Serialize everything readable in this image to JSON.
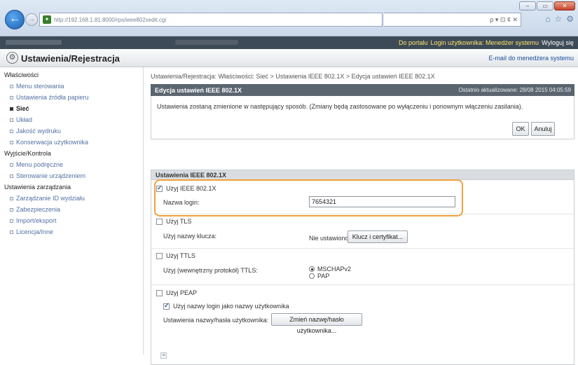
{
  "browser": {
    "window_buttons": [
      "–",
      "▭",
      "✕"
    ],
    "address_url": "http://192.168.1.81:8000/rps/ieee802xedit.cgi",
    "address_right": "ρ ▾ ⊡ ¢ ✕",
    "right_icons": [
      "⌂",
      "☆",
      "⚙"
    ]
  },
  "topbar": {
    "portal_link": "Do portalu",
    "login_label": "Login użytkownika: Menedżer systemu",
    "logout_link": "Wyloguj się"
  },
  "titlebar": {
    "icon": "gear-icon",
    "title": "Ustawienia/Rejestracja",
    "mail_link": "E-mail do menedżera systemu"
  },
  "sidebar": {
    "groups": [
      {
        "heading": "Właściwości",
        "items": [
          {
            "label": "Menu sterowania",
            "active": false
          },
          {
            "label": "Ustawienia źródła papieru",
            "active": false
          },
          {
            "label": "Sieć",
            "active": true
          },
          {
            "label": "Układ",
            "active": false
          },
          {
            "label": "Jakość wydruku",
            "active": false
          },
          {
            "label": "Konserwacja użytkownika",
            "active": false
          }
        ]
      },
      {
        "heading": "Wyjście/Kontrola",
        "items": [
          {
            "label": "Menu podręczne",
            "active": false
          },
          {
            "label": "Sterowanie urządzeniem",
            "active": false
          }
        ]
      },
      {
        "heading": "Ustawienia zarządzania",
        "items": [
          {
            "label": "Zarządzanie ID wydziału",
            "active": false
          },
          {
            "label": "Zabezpieczenia",
            "active": false
          },
          {
            "label": "Import/eksport",
            "active": false
          },
          {
            "label": "Licencja/Inne",
            "active": false
          }
        ]
      }
    ]
  },
  "main": {
    "breadcrumb": "Ustawienia/Rejestracja: Właściwości: Sieć > Ustawienia IEEE 802.1X > Edycja ustawień IEEE 802.1X",
    "panel_title": "Edycja ustawień IEEE 802.1X",
    "last_updated": "Ostatnio aktualizowane: 28/08 2015 04:05:59",
    "message": "Ustawienia zostaną zmienione w następujący sposób. (Zmiany będą zastosowane po wyłączeniu i ponownym włączeniu zasilania).",
    "ok_label": "OK",
    "cancel_label": "Anuluj",
    "section_title": "Ustawienia IEEE 802.1X",
    "use_ieee_label": "Użyj IEEE 802.1X",
    "use_ieee_checked": true,
    "login_name_label": "Nazwa login:",
    "login_name_value": "7654321",
    "use_tls_label": "Użyj TLS",
    "use_tls_checked": false,
    "key_name_label": "Użyj nazwy klucza:",
    "key_name_value": "Nie ustawiono",
    "key_cert_button": "Klucz i certyfikat...",
    "use_ttls_label": "Użyj TTLS",
    "use_ttls_checked": false,
    "ttls_protocol_label": "Użyj (wewnętrzny protokół) TTLS:",
    "ttls_options": [
      {
        "label": "MSCHAPv2",
        "selected": true
      },
      {
        "label": "PAP",
        "selected": false
      }
    ],
    "use_peap_label": "Użyj PEAP",
    "use_peap_checked": false,
    "use_login_as_username_label": "Użyj nazwy login jako nazwy użytkownika",
    "use_login_as_username_checked": true,
    "user_pass_settings_label": "Ustawienia nazwy/hasła użytkownika:",
    "change_user_pass_button": "Zmień nazwę/hasło użytkownika...",
    "highlight_color": "#f0a23b"
  }
}
